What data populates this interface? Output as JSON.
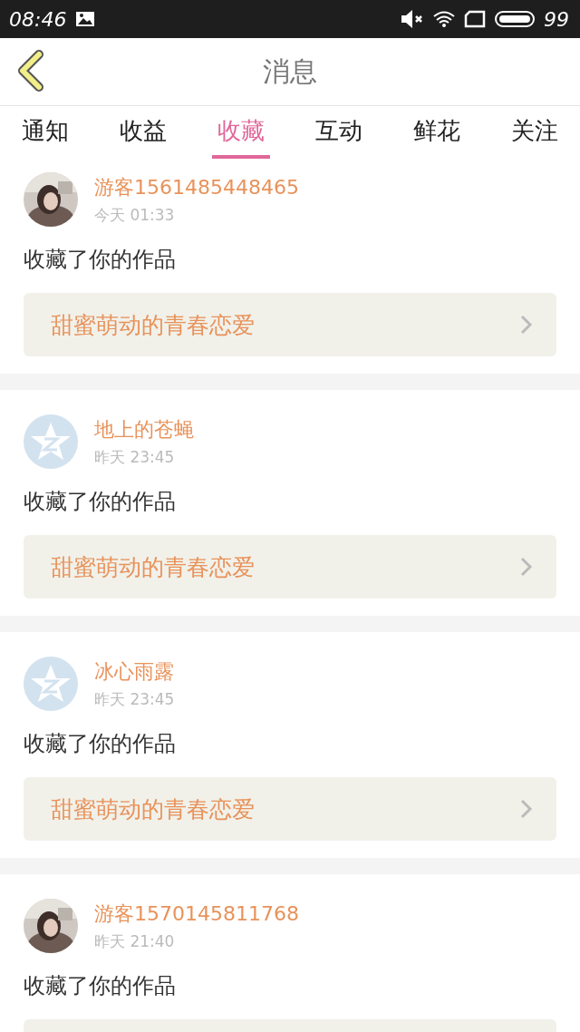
{
  "status_bar": {
    "time": "08:46",
    "battery": "99"
  },
  "header": {
    "title": "消息"
  },
  "tabs": [
    {
      "label": "通知",
      "selected": false
    },
    {
      "label": "收益",
      "selected": false
    },
    {
      "label": "收藏",
      "selected": true
    },
    {
      "label": "互动",
      "selected": false
    },
    {
      "label": "鲜花",
      "selected": false
    },
    {
      "label": "关注",
      "selected": false
    }
  ],
  "messages": [
    {
      "kind": "picture",
      "name": "游客1561485448465",
      "time": "今天 01:33",
      "text": "收藏了你的作品",
      "work": "甜蜜萌动的青春恋爱"
    },
    {
      "kind": "default",
      "name": "地上的苍蝇",
      "time": "昨天 23:45",
      "text": "收藏了你的作品",
      "work": "甜蜜萌动的青春恋爱"
    },
    {
      "kind": "default",
      "name": "冰心雨露",
      "time": "昨天 23:45",
      "text": "收藏了你的作品",
      "work": "甜蜜萌动的青春恋爱"
    },
    {
      "kind": "picture",
      "name": "游客1570145811768",
      "time": "昨天 21:40",
      "text": "收藏了你的作品"
    }
  ]
}
